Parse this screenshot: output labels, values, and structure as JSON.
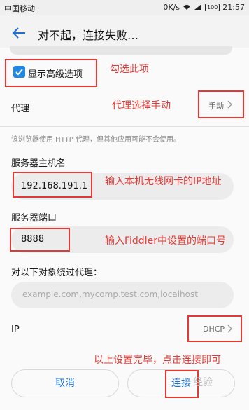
{
  "status_bar": {
    "carrier": "中国移动",
    "speed": "0K/s",
    "battery": "100",
    "time": "21:57"
  },
  "header": {
    "title": "对不起，连接失败…"
  },
  "advanced": {
    "checkbox_label": "显示高级选项",
    "checked": true,
    "annotation": "勾选此项"
  },
  "proxy": {
    "label": "代理",
    "value": "手动",
    "annotation": "代理选择手动",
    "hint": "该浏览器使用 HTTP 代理，但其他应用可能不会使用。"
  },
  "host": {
    "label": "服务器主机名",
    "value": "192.168.191.1",
    "annotation": "输入本机无线网卡的IP地址"
  },
  "port": {
    "label": "服务器端口",
    "value": "8888",
    "annotation": "输入Fiddler中设置的端口号"
  },
  "bypass": {
    "label": "对以下对象绕过代理：",
    "placeholder": "example.com,mycomp.test.com,localhost"
  },
  "ip": {
    "label": "IP",
    "value": "DHCP"
  },
  "footer": {
    "annotation": "以上设置完毕，点击连接即可",
    "cancel_label": "取消",
    "connect_label": "连接"
  },
  "watermark": "经验",
  "colors": {
    "annotation_red": "#e53935",
    "accent_blue": "#1e88e5",
    "button_text": "#1e6fd0"
  }
}
